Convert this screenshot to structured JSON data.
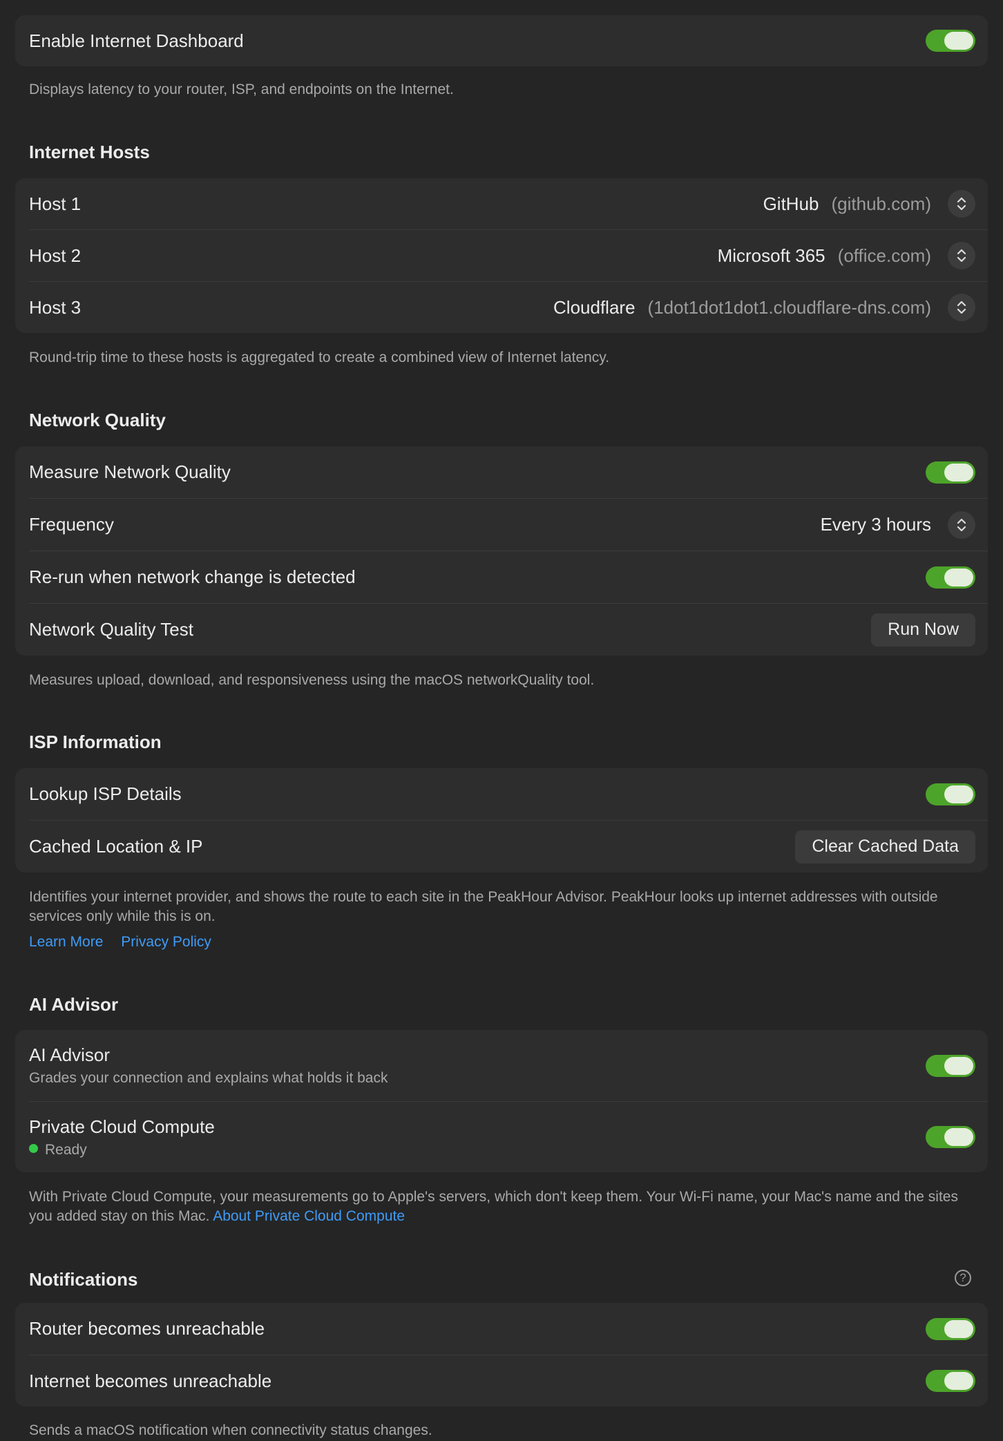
{
  "enable_dashboard": {
    "label": "Enable Internet Dashboard",
    "enabled": true,
    "footnote": "Displays latency to your router, ISP, and endpoints on the Internet."
  },
  "internet_hosts": {
    "title": "Internet Hosts",
    "hosts": [
      {
        "label": "Host 1",
        "name": "GitHub",
        "domain": "(github.com)"
      },
      {
        "label": "Host 2",
        "name": "Microsoft 365",
        "domain": "(office.com)"
      },
      {
        "label": "Host 3",
        "name": "Cloudflare",
        "domain": "(1dot1dot1dot1.cloudflare-dns.com)"
      }
    ],
    "footnote": "Round-trip time to these hosts is aggregated to create a combined view of Internet latency."
  },
  "network_quality": {
    "title": "Network Quality",
    "measure_label": "Measure Network Quality",
    "measure_enabled": true,
    "frequency_label": "Frequency",
    "frequency_value": "Every 3 hours",
    "rerun_label": "Re-run when network change is detected",
    "rerun_enabled": true,
    "test_label": "Network Quality Test",
    "run_button": "Run Now",
    "footnote": "Measures upload, download, and responsiveness using the macOS networkQuality tool."
  },
  "isp_info": {
    "title": "ISP Information",
    "lookup_label": "Lookup ISP Details",
    "lookup_enabled": true,
    "cached_label": "Cached Location & IP",
    "clear_button": "Clear Cached Data",
    "footnote": "Identifies your internet provider, and shows the route to each site in the PeakHour Advisor. PeakHour looks up internet addresses with outside services only while this is on.",
    "learn_more": "Learn More",
    "privacy_policy": "Privacy Policy"
  },
  "ai_advisor": {
    "title": "AI Advisor",
    "advisor_label": "AI Advisor",
    "advisor_sub": "Grades your connection and explains what holds it back",
    "advisor_enabled": true,
    "pcc_label": "Private Cloud Compute",
    "pcc_status": "Ready",
    "pcc_status_color": "#35c94a",
    "pcc_enabled": true,
    "footnote": "With Private Cloud Compute, your measurements go to Apple's servers, which don't keep them. Your Wi-Fi name, your Mac's name and the sites you added stay on this Mac.",
    "footnote_link": "About Private Cloud Compute"
  },
  "notifications": {
    "title": "Notifications",
    "help_icon": "?",
    "router_label": "Router becomes unreachable",
    "router_enabled": true,
    "internet_label": "Internet becomes unreachable",
    "internet_enabled": true,
    "footnote": "Sends a macOS notification when connectivity status changes."
  },
  "colors": {
    "background": "#252525",
    "card": "#2d2d2d",
    "toggle_on": "#4da42a",
    "link": "#3f9bf8"
  }
}
